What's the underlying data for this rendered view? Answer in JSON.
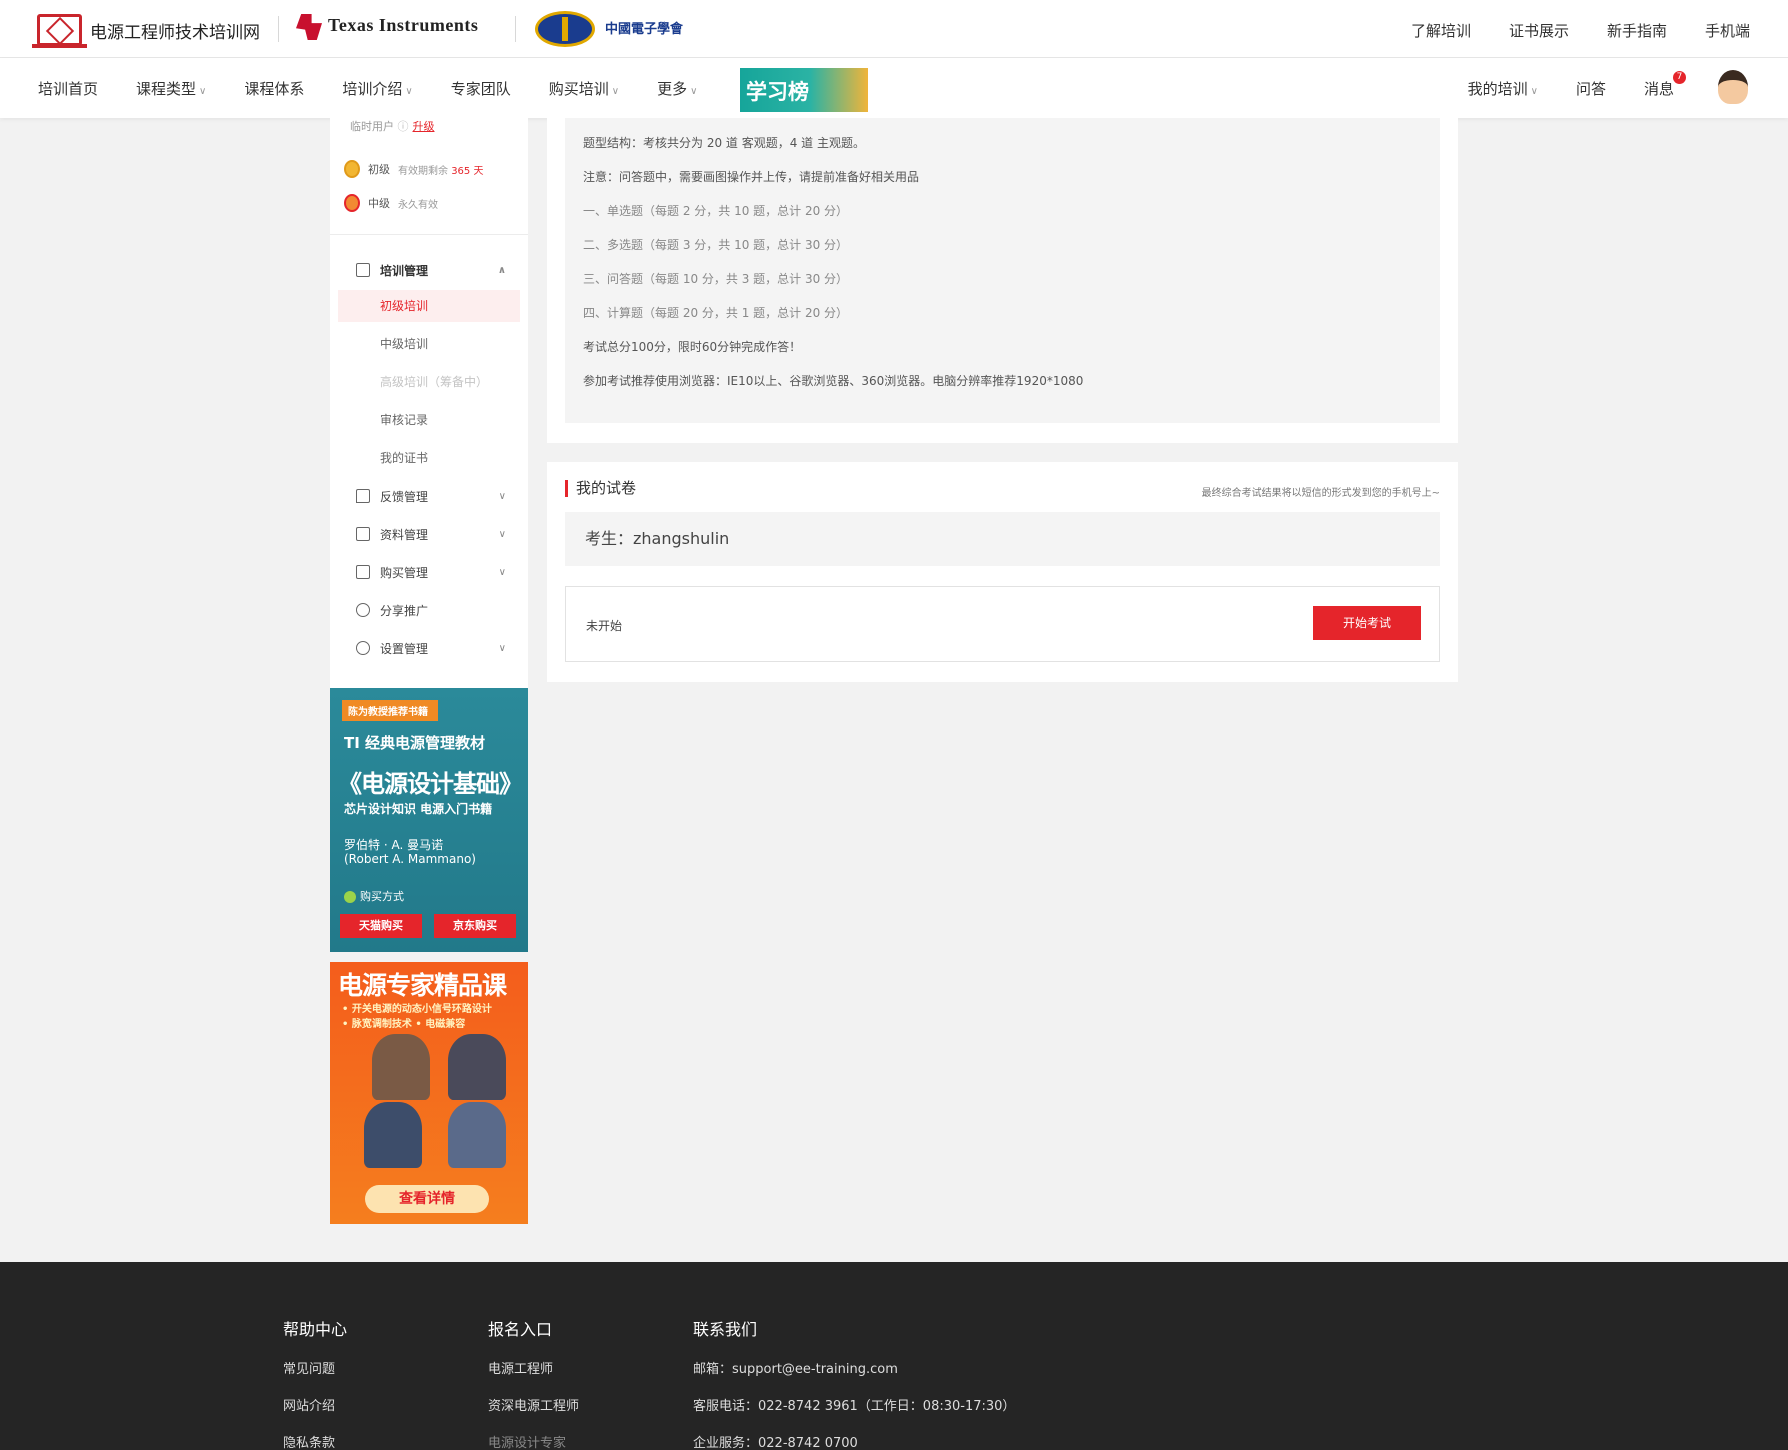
{
  "header": {
    "site_name": "电源工程师技术培训网",
    "ti_logo": "Texas Instruments",
    "cie_logo": "中國電子學會",
    "links": [
      "了解培训",
      "证书展示",
      "新手指南",
      "手机端"
    ]
  },
  "nav": {
    "items": [
      {
        "label": "培训首页",
        "dropdown": false
      },
      {
        "label": "课程类型",
        "dropdown": true
      },
      {
        "label": "课程体系",
        "dropdown": false
      },
      {
        "label": "培训介绍",
        "dropdown": true
      },
      {
        "label": "专家团队",
        "dropdown": false
      },
      {
        "label": "购买培训",
        "dropdown": true
      },
      {
        "label": "更多",
        "dropdown": true
      }
    ],
    "banner": "学习榜",
    "my_training": "我的培训",
    "qa": "问答",
    "messages": "消息",
    "message_count": "7"
  },
  "sidebar": {
    "user_type": "临时用户",
    "upgrade": "升级",
    "levels": [
      {
        "name": "初级",
        "prefix": "有效期剩余",
        "days": "365",
        "suffix": "天"
      },
      {
        "name": "中级",
        "prefix": "永久有效",
        "days": "",
        "suffix": ""
      }
    ],
    "menu_training": "培训管理",
    "sub_items": [
      "初级培训",
      "中级培训",
      "高级培训（筹备中）",
      "审核记录",
      "我的证书"
    ],
    "menu_feedback": "反馈管理",
    "menu_materials": "资料管理",
    "menu_purchase": "购买管理",
    "menu_share": "分享推广",
    "menu_settings": "设置管理"
  },
  "ad_book": {
    "tag": "陈为教授推荐书籍",
    "line1": "TI 经典电源管理教材",
    "title": "《电源设计基础》",
    "subtitle": "芯片设计知识 电源入门书籍",
    "author_cn": "罗伯特 · A. 曼马诺",
    "author_en": "(Robert A. Mammano)",
    "buy_label": "购买方式",
    "tmall": "天猫购买",
    "jd": "京东购买"
  },
  "ad_course": {
    "title": "电源专家精品课",
    "bullet1": "• 开关电源的动态小信号环路设计",
    "bullet2": "• 脉宽调制技术 • 电磁兼容",
    "detail": "查看详情"
  },
  "exam_info": {
    "lines": [
      "题型结构：考核共分为 20 道 客观题，4 道 主观题。",
      "注意：问答题中，需要画图操作并上传，请提前准备好相关用品",
      "一、单选题（每题 2 分，共 10 题，总计 20 分）",
      "二、多选题（每题 3 分，共 10 题，总计 30 分）",
      "三、问答题（每题 10 分，共 3 题，总计 30 分）",
      "四、计算题（每题 20 分，共 1 题，总计 20 分）",
      "考试总分100分，限时60分钟完成作答！",
      "参加考试推荐使用浏览器：IE10以上、谷歌浏览器、360浏览器。电脑分辨率推荐1920*1080"
    ]
  },
  "my_paper": {
    "title": "我的试卷",
    "note": "最终综合考试结果将以短信的形式发到您的手机号上~",
    "examinee": "考生：zhangshulin",
    "status": "未开始",
    "start_button": "开始考试"
  },
  "footer": {
    "help_title": "帮助中心",
    "help_links": [
      "常见问题",
      "网站介绍",
      "隐私条款"
    ],
    "signup_title": "报名入口",
    "signup_links": [
      "电源工程师",
      "资深电源工程师",
      "电源设计专家"
    ],
    "contact_title": "联系我们",
    "contact_lines": [
      "邮箱：support@ee-training.com",
      "客服电话：022-8742 3961（工作日：08:30-17:30）",
      "企业服务：022-8742 0700"
    ]
  }
}
